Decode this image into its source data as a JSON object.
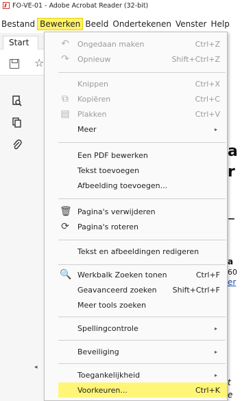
{
  "window": {
    "title": "FO-VE-01 - Adobe Acrobat Reader (32-bit)"
  },
  "menubar": {
    "items": [
      "Bestand",
      "Bewerken",
      "Beeld",
      "Ondertekenen",
      "Venster",
      "Help"
    ],
    "active": "Bewerken"
  },
  "tabs": {
    "start": "Start",
    "close_glyph": "×"
  },
  "toolbar": {
    "save_icon": "save-icon",
    "star_icon": "star-icon"
  },
  "rail": {
    "icons": [
      "search-document-icon",
      "copy-pages-icon",
      "paperclip-icon"
    ],
    "collapse_glyph": "◂"
  },
  "doc_glyphs": [
    "a",
    "r",
    "–",
    "a",
    "60",
    "er",
    "t",
    "e",
    "ab"
  ],
  "menu": {
    "undo": {
      "label": "Ongedaan maken",
      "shortcut": "Ctrl+Z"
    },
    "redo": {
      "label": "Opnieuw",
      "shortcut": "Shift+Ctrl+Z"
    },
    "cut": {
      "label": "Knippen",
      "shortcut": "Ctrl+X"
    },
    "copy": {
      "label": "Kopiëren",
      "shortcut": "Ctrl+C"
    },
    "paste": {
      "label": "Plakken",
      "shortcut": "Ctrl+V"
    },
    "more": {
      "label": "Meer"
    },
    "edit_pdf": {
      "label": "Een PDF bewerken"
    },
    "add_text": {
      "label": "Tekst toevoegen"
    },
    "add_image": {
      "label": "Afbeelding toevoegen..."
    },
    "delete_pages": {
      "label": "Pagina's verwijderen"
    },
    "rotate_pages": {
      "label": "Pagina's roteren"
    },
    "edit_text_images": {
      "label": "Tekst en afbeeldingen redigeren"
    },
    "show_search": {
      "label": "Werkbalk Zoeken tonen",
      "shortcut": "Ctrl+F"
    },
    "advanced_search": {
      "label": "Geavanceerd zoeken",
      "shortcut": "Shift+Ctrl+F"
    },
    "more_tools": {
      "label": "Meer tools zoeken"
    },
    "spelling": {
      "label": "Spellingcontrole"
    },
    "security": {
      "label": "Beveiliging"
    },
    "accessibility": {
      "label": "Toegankelijkheid"
    },
    "preferences": {
      "label": "Voorkeuren...",
      "shortcut": "Ctrl+K"
    }
  },
  "colors": {
    "highlight": "#fff266",
    "disabled": "#9a9a9a",
    "pdf_red": "#d0342c"
  }
}
